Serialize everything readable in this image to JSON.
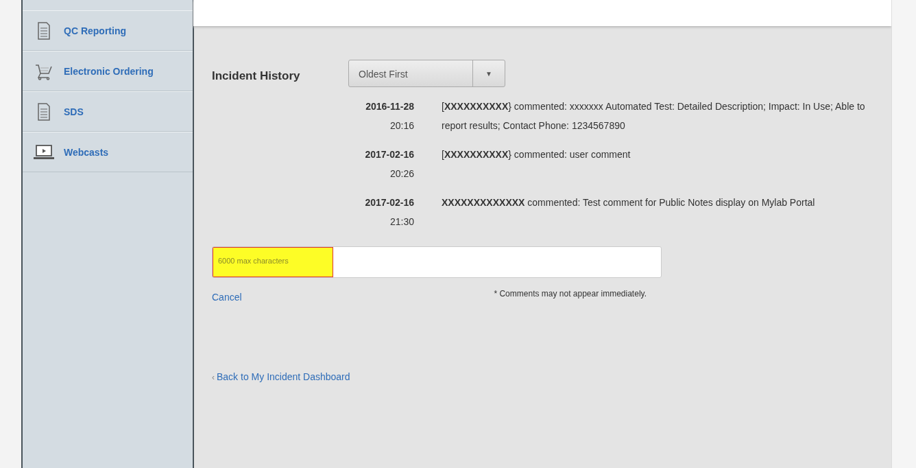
{
  "sidebar": {
    "items": [
      {
        "label": "QC Reporting",
        "kind": "document"
      },
      {
        "label": "Electronic Ordering",
        "kind": "cart"
      },
      {
        "label": "SDS",
        "kind": "document"
      },
      {
        "label": "Webcasts",
        "kind": "video"
      }
    ]
  },
  "history": {
    "title": "Incident History",
    "sort": {
      "value": "Oldest First",
      "arrow": "▼"
    },
    "entries": [
      {
        "date": "2016-11-28",
        "time": "20:16",
        "text": "[**XXXXXXXXXX**} commented: xxxxxxx Automated Test: Detailed Description; Impact: In Use; Able to report results; Contact Phone: 1234567890"
      },
      {
        "date": "2017-02-16",
        "time": "20:26",
        "text": "[**XXXXXXXXXX**} commented: user comment"
      },
      {
        "date": "2017-02-16",
        "time": "21:30",
        "text": "**XXXXXXXXXXXXX** commented: Test comment for Public Notes display on Mylab Portal"
      }
    ]
  },
  "comment": {
    "placeholder": "6000 max characters",
    "highlighted": true,
    "cancel": "Cancel",
    "note": "* Comments may not appear immediately."
  },
  "back_link": {
    "arrow": "‹",
    "label": "Back to My Incident Dashboard"
  }
}
